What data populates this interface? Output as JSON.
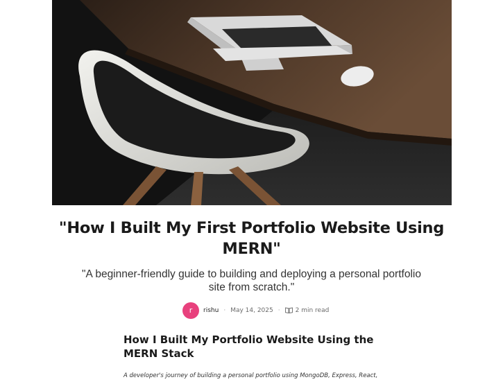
{
  "post": {
    "title": "\"How I Built My First Portfolio Website Using MERN\"",
    "subtitle": "\"A beginner-friendly guide to building and deploying a personal portfolio site from scratch.\"",
    "author": {
      "initial": "r",
      "name": "rishu",
      "avatar_color": "#e8417d"
    },
    "date": "May 14, 2025",
    "separator": "·",
    "read_time": "2 min read",
    "hero_icon": "desk-chair-laptop-photo"
  },
  "article": {
    "heading": "How I Built My Portfolio Website Using the MERN Stack",
    "intro": "A developer's journey of building a personal portfolio using MongoDB, Express, React,"
  }
}
